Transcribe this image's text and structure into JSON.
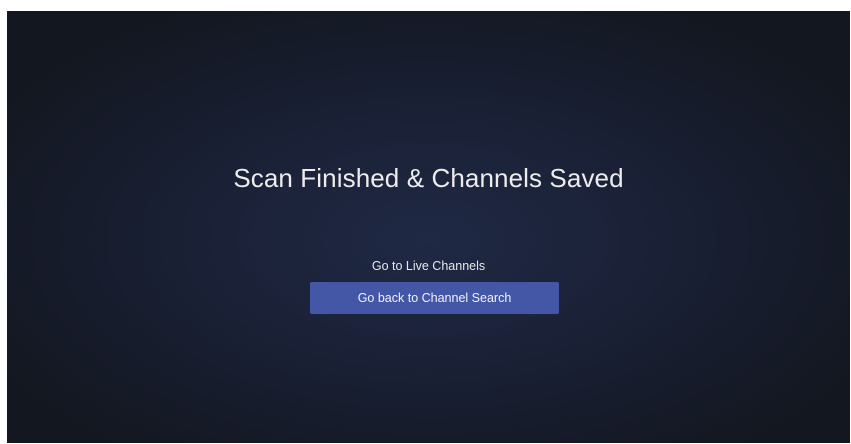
{
  "screen": {
    "title": "Scan Finished & Channels Saved"
  },
  "options": {
    "live_channels_label": "Go to Live Channels",
    "channel_search_label": "Go back to Channel Search"
  },
  "colors": {
    "background": "#1b2238",
    "accent": "#4456a6",
    "text": "#ececec"
  }
}
